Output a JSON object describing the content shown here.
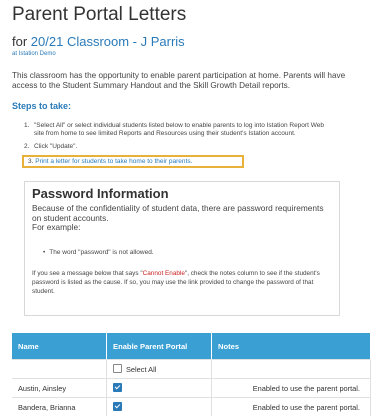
{
  "page": {
    "title": "Parent Portal Letters",
    "subtitle_prefix": "for",
    "classroom_link": "20/21 Classroom - J Parris",
    "org": "at Istation Demo",
    "intro": "This classroom has the opportunity to enable parent participation at home. Parents will have access to the Student Summary Handout and the Skill Growth Detail reports.",
    "steps_heading": "Steps to take:",
    "steps": [
      {
        "num": "1.",
        "text": "\"Select All\" or select individual students listed below to enable parents to log into Istation Report Web",
        "text2": "site from home to see limited Reports and Resources using their student's Istation account."
      },
      {
        "num": "2.",
        "text": "Click \"Update\"."
      }
    ],
    "step3": {
      "num": "3.",
      "link": "Print a letter for students to take home to their parents."
    }
  },
  "password_info": {
    "title": "Password Information",
    "text": "Because of the confidentiality of student data, there are password requirements on student accounts.",
    "example": "For example:",
    "bullet": "The word \"password\" is not allowed.",
    "note_pre": "If you see a message below that says \"",
    "note_red": "Cannot Enable",
    "note_post": "\", check the notes column to see if the student's password is listed as the cause. If so, you may use the link provided to change the password of that student."
  },
  "table": {
    "headers": [
      "Name",
      "Enable Parent Portal",
      "Notes"
    ],
    "select_all": "Select All",
    "rows": [
      {
        "name": "Austin, Ainsley",
        "note": "Enabled to use the parent portal."
      },
      {
        "name": "Bandera, Brianna",
        "note": "Enabled to use the parent portal."
      }
    ]
  },
  "colors": {
    "accent": "#2a7ab8",
    "header_bg": "#3aa0d4",
    "highlight": "#e8b23a",
    "error": "#cc2222"
  }
}
